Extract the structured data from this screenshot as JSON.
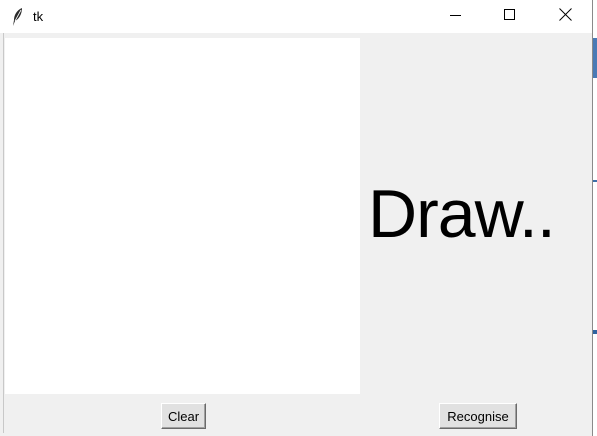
{
  "window": {
    "title": "tk",
    "icon": "feather-icon",
    "controls": [
      "minimize-icon",
      "maximize-icon",
      "close-icon"
    ]
  },
  "main": {
    "status_text": "Draw..",
    "clear_label": "Clear",
    "recognise_label": "Recognise"
  },
  "colors": {
    "window_bg": "#f0f0f0",
    "canvas_bg": "#ffffff",
    "titlebar_bg": "#ffffff",
    "text": "#000000"
  }
}
